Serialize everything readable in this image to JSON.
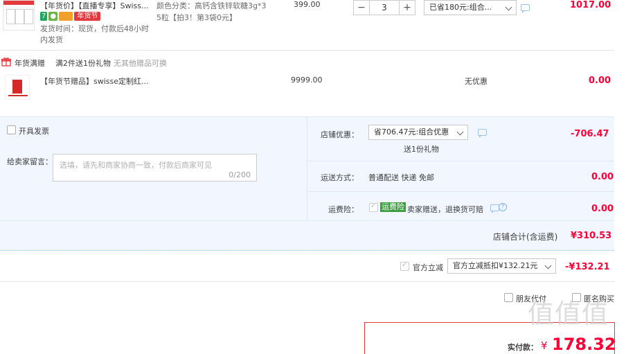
{
  "product1": {
    "title": "【年货价】【直播专享】Swiss...",
    "badges": [
      "7",
      "年货节"
    ],
    "shipping": "发货时间：现货，付款后48小时",
    "shipping2": "内发货",
    "spec1": "颜色分类：高钙含铁锌软糖3g*3",
    "spec2": "5粒【拍3！第3袋0元】",
    "price": "399.00",
    "qty": "3",
    "qty_minus": "−",
    "qty_plus": "+",
    "discount_select": "已省180元:组合...",
    "subtotal": "1017.00"
  },
  "gift_promo": {
    "label": "年货满赠",
    "desc": "满2件送1份礼物",
    "note": "无其他赠品可换"
  },
  "product2": {
    "title": "【年货节赠品】swisse定制红...",
    "price": "9999.00",
    "discount": "无优惠",
    "subtotal": "0.00"
  },
  "options": {
    "invoice_label": "开具发票",
    "message_label": "给卖家留言：",
    "message_placeholder": "选填，请先和商家协商一致，付款后商家可见",
    "message_count": "0/200"
  },
  "shop_discount": {
    "label": "店铺优惠：",
    "select": "省706.47元:组合优惠",
    "sub": "送1份礼物",
    "amount": "-706.47"
  },
  "delivery": {
    "label": "运送方式：",
    "value": "普通配送 快递 免邮",
    "amount": "0.00"
  },
  "insurance": {
    "label": "运费险：",
    "tag": "运费险",
    "desc": "卖家赠送，退换货可赔",
    "amount": "0.00"
  },
  "shop_total": {
    "label": "店铺合计(含运费)",
    "amount": "¥310.53"
  },
  "official": {
    "label": "官方立减",
    "select": "官方立减抵扣¥132.21元",
    "amount": "-¥132.21"
  },
  "checkout": {
    "friend_pay": "朋友代付",
    "anonymous": "匿名购买",
    "pay_label": "实付款：",
    "pay_currency": "¥",
    "pay_amount": "178.32"
  },
  "watermark": "值值值",
  "chart_data": {
    "type": "table",
    "rows": [
      {
        "item": "【年货价】【直播专享】Swiss...",
        "price": 399.0,
        "qty": 3,
        "subtotal": 1017.0
      },
      {
        "item": "【年货节赠品】swisse定制红...",
        "price": 9999.0,
        "qty": null,
        "subtotal": 0.0
      }
    ],
    "shop_discount": -706.47,
    "delivery": 0.0,
    "insurance": 0.0,
    "shop_total": 310.53,
    "official_discount": -132.21,
    "pay": 178.32
  }
}
